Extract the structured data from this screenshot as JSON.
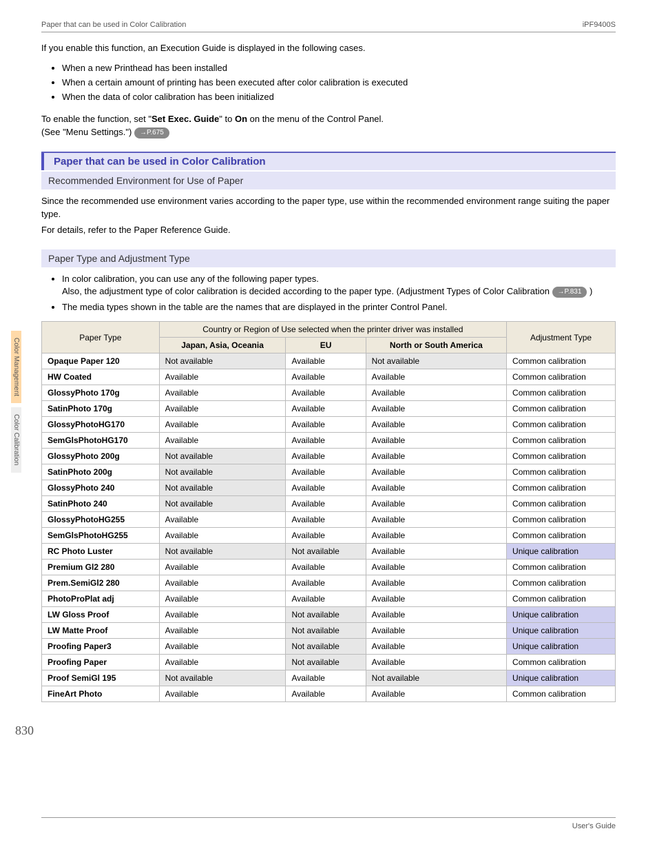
{
  "header": {
    "left": "Paper that can be used in Color Calibration",
    "right": "iPF9400S"
  },
  "intro": {
    "lead": "If you enable this function, an Execution Guide is displayed in the following cases.",
    "bullets": [
      "When a new Printhead has been installed",
      "When a certain amount of printing has been executed after color calibration is executed",
      "When the data of color calibration has been initialized"
    ],
    "enable_pre": "To enable the function, set \"",
    "enable_bold1": "Set Exec. Guide",
    "enable_mid": "\" to ",
    "enable_bold2": "On",
    "enable_post": " on the menu of the Control Panel.",
    "see": " (See \"Menu Settings.\") ",
    "pill1": "→P.675"
  },
  "section": {
    "title": "Paper that can be used in Color Calibration"
  },
  "sub1": {
    "title": "Recommended Environment for Use of Paper",
    "p1": "Since the recommended use environment varies according to the paper type, use within the recommended environment range suiting the paper type.",
    "p2": "For details, refer to the Paper Reference Guide."
  },
  "sub2": {
    "title": "Paper Type and Adjustment Type",
    "b1": "In color calibration, you can use any of the following paper types.",
    "b1b": "Also, the adjustment type of color calibration is decided according to the paper type. (Adjustment Types of Color Calibration ",
    "pill2": "→P.831",
    "b1c": " )",
    "b2": "The media types shown in the table are the names that are displayed in the printer Control Panel."
  },
  "table": {
    "h_paper": "Paper Type",
    "h_country": "Country or Region of Use selected when the printer driver was installed",
    "h_adj": "Adjustment Type",
    "h_jp": "Japan, Asia, Oceania",
    "h_eu": "EU",
    "h_na": "North or South America"
  },
  "chart_data": {
    "type": "table",
    "columns": [
      "Paper Type",
      "Japan, Asia, Oceania",
      "EU",
      "North or South America",
      "Adjustment Type"
    ],
    "rows": [
      {
        "paper": "Opaque Paper 120",
        "jp": "Not available",
        "eu": "Available",
        "na": "Not available",
        "adj": "Common calibration"
      },
      {
        "paper": "HW Coated",
        "jp": "Available",
        "eu": "Available",
        "na": "Available",
        "adj": "Common calibration"
      },
      {
        "paper": "GlossyPhoto 170g",
        "jp": "Available",
        "eu": "Available",
        "na": "Available",
        "adj": "Common calibration"
      },
      {
        "paper": "SatinPhoto 170g",
        "jp": "Available",
        "eu": "Available",
        "na": "Available",
        "adj": "Common calibration"
      },
      {
        "paper": "GlossyPhotoHG170",
        "jp": "Available",
        "eu": "Available",
        "na": "Available",
        "adj": "Common calibration"
      },
      {
        "paper": "SemGlsPhotoHG170",
        "jp": "Available",
        "eu": "Available",
        "na": "Available",
        "adj": "Common calibration"
      },
      {
        "paper": "GlossyPhoto 200g",
        "jp": "Not available",
        "eu": "Available",
        "na": "Available",
        "adj": "Common calibration"
      },
      {
        "paper": "SatinPhoto 200g",
        "jp": "Not available",
        "eu": "Available",
        "na": "Available",
        "adj": "Common calibration"
      },
      {
        "paper": "GlossyPhoto 240",
        "jp": "Not available",
        "eu": "Available",
        "na": "Available",
        "adj": "Common calibration"
      },
      {
        "paper": "SatinPhoto 240",
        "jp": "Not available",
        "eu": "Available",
        "na": "Available",
        "adj": "Common calibration"
      },
      {
        "paper": "GlossyPhotoHG255",
        "jp": "Available",
        "eu": "Available",
        "na": "Available",
        "adj": "Common calibration"
      },
      {
        "paper": "SemGlsPhotoHG255",
        "jp": "Available",
        "eu": "Available",
        "na": "Available",
        "adj": "Common calibration"
      },
      {
        "paper": "RC Photo Luster",
        "jp": "Not available",
        "eu": "Not available",
        "na": "Available",
        "adj": "Unique calibration"
      },
      {
        "paper": "Premium Gl2 280",
        "jp": "Available",
        "eu": "Available",
        "na": "Available",
        "adj": "Common calibration"
      },
      {
        "paper": "Prem.SemiGl2 280",
        "jp": "Available",
        "eu": "Available",
        "na": "Available",
        "adj": "Common calibration"
      },
      {
        "paper": "PhotoProPlat adj",
        "jp": "Available",
        "eu": "Available",
        "na": "Available",
        "adj": "Common calibration"
      },
      {
        "paper": "LW Gloss Proof",
        "jp": "Available",
        "eu": "Not available",
        "na": "Available",
        "adj": "Unique calibration"
      },
      {
        "paper": "LW Matte Proof",
        "jp": "Available",
        "eu": "Not available",
        "na": "Available",
        "adj": "Unique calibration"
      },
      {
        "paper": "Proofing Paper3",
        "jp": "Available",
        "eu": "Not available",
        "na": "Available",
        "adj": "Unique calibration"
      },
      {
        "paper": "Proofing Paper",
        "jp": "Available",
        "eu": "Not available",
        "na": "Available",
        "adj": "Common calibration"
      },
      {
        "paper": "Proof SemiGl 195",
        "jp": "Not available",
        "eu": "Available",
        "na": "Not available",
        "adj": "Unique calibration"
      },
      {
        "paper": "FineArt Photo",
        "jp": "Available",
        "eu": "Available",
        "na": "Available",
        "adj": "Common calibration"
      }
    ]
  },
  "sidetabs": {
    "t1": "Color Management",
    "t2": "Color Calibration"
  },
  "page_number": "830",
  "footer": "User's Guide"
}
